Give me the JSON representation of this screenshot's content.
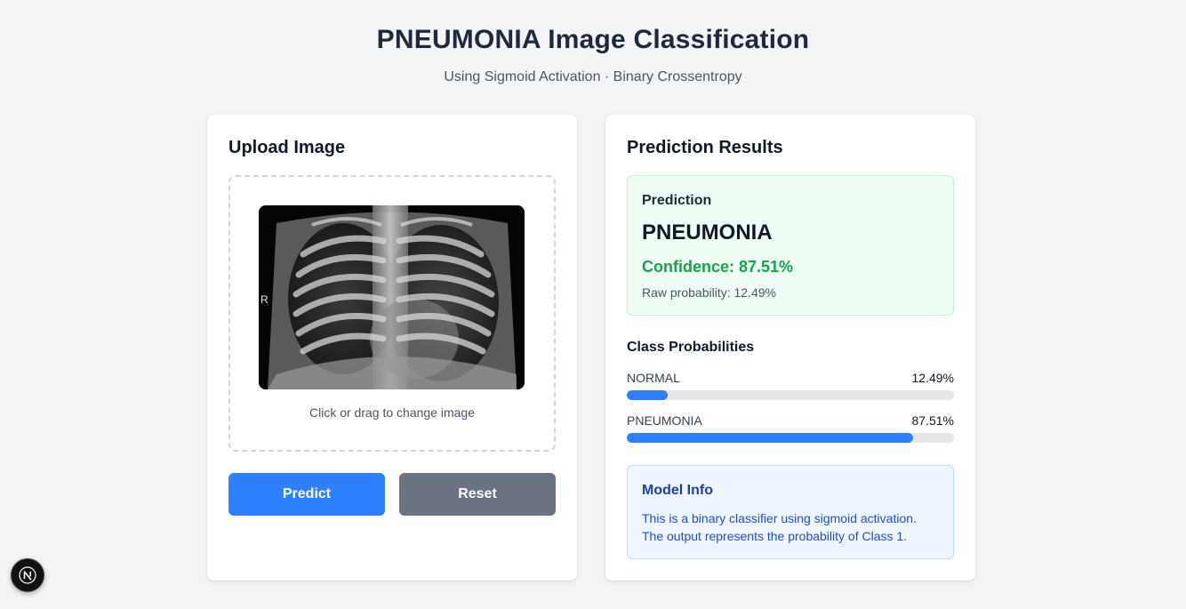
{
  "header": {
    "title": "PNEUMONIA Image Classification",
    "subtitle": "Using Sigmoid Activation · Binary Crossentropy"
  },
  "upload": {
    "title": "Upload Image",
    "image_marker": "R",
    "hint": "Click or drag to change image",
    "predict_label": "Predict",
    "reset_label": "Reset"
  },
  "results": {
    "title": "Prediction Results",
    "prediction_label": "Prediction",
    "predicted_class": "PNEUMONIA",
    "confidence": "Confidence: 87.51%",
    "raw_probability": "Raw probability: 12.49%",
    "probabilities_title": "Class Probabilities",
    "classes": [
      {
        "name": "NORMAL",
        "value_text": "12.49%",
        "value": 12.49
      },
      {
        "name": "PNEUMONIA",
        "value_text": "87.51%",
        "value": 87.51
      }
    ],
    "model_info": {
      "title": "Model Info",
      "line1": "This is a binary classifier using sigmoid activation.",
      "line2": "The output represents the probability of Class 1."
    }
  },
  "colors": {
    "accent": "#2f80ff",
    "reset": "#6b7280",
    "success": "#16a34a",
    "info": "#1d4ed8"
  },
  "icons": {
    "dev_badge": "nextjs-logo-icon"
  }
}
